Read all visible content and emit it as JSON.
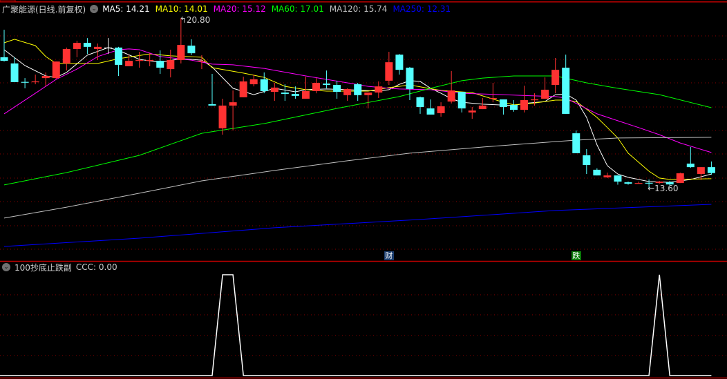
{
  "header": {
    "title": "广聚能源(日线.前复权)",
    "ma_labels": [
      {
        "text": "MA5: 14.21",
        "color": "#ffffff"
      },
      {
        "text": "MA10: 14.01",
        "color": "#ffff00"
      },
      {
        "text": "MA20: 15.12",
        "color": "#ff00ff"
      },
      {
        "text": "MA60: 17.01",
        "color": "#00ff00"
      },
      {
        "text": "MA120: 15.74",
        "color": "#c0c0c0"
      },
      {
        "text": "MA250: 12.31",
        "color": "#0000ff"
      }
    ]
  },
  "annotations": {
    "high": "20.80",
    "low": "13.60"
  },
  "markers": [
    {
      "text": "财",
      "candle": 37,
      "bg": "#1a3d6e"
    },
    {
      "text": "跌",
      "candle": 55,
      "bg": "#0a7a0a"
    }
  ],
  "indicator": {
    "title": "100抄底止跌副",
    "value_label": "CCC: 0.00",
    "signal_candles": [
      21,
      22,
      63
    ]
  },
  "colors": {
    "up": "#ff3232",
    "down": "#54ffff",
    "grid": "#8b0000",
    "separator": "#c00000"
  },
  "chart_data": {
    "type": "candlestick",
    "price_range": [
      11.0,
      20.8
    ],
    "candles": [
      [
        19.14,
        20.3,
        18.96,
        18.99
      ],
      [
        18.88,
        19.14,
        18.09,
        18.09
      ],
      [
        18.1,
        18.26,
        17.83,
        18.09
      ],
      [
        18.11,
        18.41,
        18.0,
        18.12
      ],
      [
        18.26,
        18.5,
        17.91,
        18.35
      ],
      [
        18.26,
        18.96,
        18.22,
        18.96
      ],
      [
        18.88,
        19.55,
        18.58,
        19.49
      ],
      [
        19.49,
        19.84,
        19.14,
        19.75
      ],
      [
        19.75,
        19.95,
        19.28,
        19.58
      ],
      [
        19.49,
        19.72,
        19.02,
        19.58
      ],
      [
        19.55,
        19.95,
        19.28,
        19.55
      ],
      [
        19.55,
        19.58,
        18.35,
        18.82
      ],
      [
        18.76,
        19.25,
        18.76,
        18.99
      ],
      [
        19.01,
        19.37,
        18.7,
        19.02
      ],
      [
        19.01,
        19.31,
        18.76,
        19.02
      ],
      [
        18.99,
        19.43,
        18.44,
        18.7
      ],
      [
        18.64,
        19.46,
        18.29,
        19.02
      ],
      [
        19.02,
        20.8,
        18.88,
        19.66
      ],
      [
        19.63,
        19.9,
        19.23,
        19.31
      ],
      [
        18.98,
        19.23,
        18.64,
        18.99
      ],
      [
        17.16,
        18.44,
        17.1,
        17.1
      ],
      [
        16.14,
        17.39,
        15.87,
        17.1
      ],
      [
        17.1,
        17.74,
        16.05,
        17.24
      ],
      [
        17.45,
        18.32,
        17.45,
        18.12
      ],
      [
        18.0,
        18.41,
        17.91,
        18.21
      ],
      [
        18.21,
        18.5,
        17.62,
        17.71
      ],
      [
        17.68,
        18.06,
        17.3,
        17.86
      ],
      [
        17.65,
        18.0,
        17.3,
        17.59
      ],
      [
        17.59,
        17.91,
        17.39,
        17.51
      ],
      [
        17.39,
        18.32,
        17.39,
        17.71
      ],
      [
        17.71,
        18.26,
        17.62,
        18.06
      ],
      [
        18.03,
        18.58,
        17.83,
        17.97
      ],
      [
        17.97,
        18.15,
        17.39,
        17.68
      ],
      [
        17.54,
        17.83,
        17.3,
        17.8
      ],
      [
        18.0,
        18.06,
        17.3,
        17.54
      ],
      [
        17.54,
        17.65,
        16.98,
        17.65
      ],
      [
        17.65,
        18.12,
        17.42,
        17.91
      ],
      [
        18.15,
        19.37,
        17.97,
        18.93
      ],
      [
        19.25,
        19.28,
        18.41,
        18.61
      ],
      [
        18.7,
        18.73,
        17.33,
        17.8
      ],
      [
        17.45,
        17.48,
        16.75,
        17.04
      ],
      [
        16.98,
        17.36,
        16.72,
        16.72
      ],
      [
        16.78,
        17.24,
        16.63,
        17.07
      ],
      [
        17.27,
        18.56,
        17.19,
        17.74
      ],
      [
        17.68,
        17.68,
        16.81,
        16.98
      ],
      [
        16.81,
        17.04,
        16.54,
        16.89
      ],
      [
        16.95,
        17.42,
        16.95,
        17.1
      ],
      [
        17.41,
        18.06,
        17.24,
        17.42
      ],
      [
        17.36,
        17.36,
        16.72,
        17.04
      ],
      [
        17.13,
        17.33,
        16.84,
        16.92
      ],
      [
        16.92,
        17.94,
        16.81,
        17.33
      ],
      [
        17.35,
        17.62,
        17.1,
        17.36
      ],
      [
        17.39,
        18.29,
        17.39,
        17.77
      ],
      [
        17.97,
        19.11,
        17.62,
        18.61
      ],
      [
        18.7,
        19.25,
        16.75,
        16.75
      ],
      [
        15.93,
        16.05,
        15.09,
        15.09
      ],
      [
        15.0,
        15.26,
        14.21,
        14.59
      ],
      [
        14.39,
        14.45,
        14.15,
        14.15
      ],
      [
        14.07,
        14.27,
        14.04,
        14.15
      ],
      [
        14.15,
        14.15,
        13.76,
        13.89
      ],
      [
        13.86,
        13.89,
        13.76,
        13.8
      ],
      [
        13.8,
        13.89,
        13.8,
        13.83
      ],
      [
        13.84,
        13.98,
        13.6,
        13.83
      ],
      [
        13.83,
        13.92,
        13.8,
        13.89
      ],
      [
        13.86,
        13.92,
        13.74,
        13.77
      ],
      [
        13.83,
        14.27,
        13.83,
        14.24
      ],
      [
        14.65,
        15.35,
        14.47,
        14.5
      ],
      [
        14.21,
        14.5,
        13.95,
        14.5
      ],
      [
        14.5,
        14.74,
        14.18,
        14.25
      ]
    ],
    "moving_averages": [
      {
        "name": "MA5",
        "color": "#ffffff",
        "points": [
          [
            0,
            19.46
          ],
          [
            2,
            18.79
          ],
          [
            4,
            18.35
          ],
          [
            5,
            18.29
          ],
          [
            6,
            18.5
          ],
          [
            8,
            19.23
          ],
          [
            10,
            19.55
          ],
          [
            11,
            19.43
          ],
          [
            13,
            19.05
          ],
          [
            15,
            18.93
          ],
          [
            17,
            19.08
          ],
          [
            19,
            19.02
          ],
          [
            20,
            18.73
          ],
          [
            22,
            17.83
          ],
          [
            24,
            17.56
          ],
          [
            26,
            17.83
          ],
          [
            28,
            17.68
          ],
          [
            29,
            17.77
          ],
          [
            31,
            17.8
          ],
          [
            33,
            17.77
          ],
          [
            36,
            17.71
          ],
          [
            37,
            17.77
          ],
          [
            38,
            18.0
          ],
          [
            39,
            18.15
          ],
          [
            40,
            18.12
          ],
          [
            41,
            17.83
          ],
          [
            42,
            17.62
          ],
          [
            43,
            17.39
          ],
          [
            44,
            17.24
          ],
          [
            46,
            17.16
          ],
          [
            49,
            17.1
          ],
          [
            50,
            17.19
          ],
          [
            52,
            17.27
          ],
          [
            53,
            17.56
          ],
          [
            54,
            17.59
          ],
          [
            55,
            17.33
          ],
          [
            56,
            16.6
          ],
          [
            57,
            15.44
          ],
          [
            58,
            14.56
          ],
          [
            59,
            14.21
          ],
          [
            60,
            14.07
          ],
          [
            62,
            13.89
          ],
          [
            64,
            13.86
          ],
          [
            66,
            13.98
          ],
          [
            68,
            14.21
          ]
        ]
      },
      {
        "name": "MA10",
        "color": "#ffff00",
        "points": [
          [
            0,
            19.75
          ],
          [
            1,
            19.9
          ],
          [
            3,
            19.63
          ],
          [
            4,
            19.17
          ],
          [
            5,
            18.88
          ],
          [
            9,
            18.88
          ],
          [
            11,
            19.08
          ],
          [
            14,
            19.28
          ],
          [
            16,
            19.2
          ],
          [
            19,
            19.14
          ],
          [
            20,
            18.7
          ],
          [
            23,
            18.47
          ],
          [
            25,
            18.29
          ],
          [
            27,
            17.91
          ],
          [
            29,
            17.77
          ],
          [
            31,
            17.71
          ],
          [
            35,
            17.71
          ],
          [
            37,
            17.86
          ],
          [
            39,
            17.97
          ],
          [
            40,
            17.89
          ],
          [
            42,
            17.74
          ],
          [
            45,
            17.65
          ],
          [
            46,
            17.51
          ],
          [
            48,
            17.24
          ],
          [
            49,
            17.13
          ],
          [
            51,
            17.21
          ],
          [
            53,
            17.33
          ],
          [
            54,
            17.33
          ],
          [
            55,
            17.27
          ],
          [
            56,
            16.95
          ],
          [
            57,
            16.6
          ],
          [
            58,
            16.17
          ],
          [
            59,
            15.73
          ],
          [
            60,
            15.09
          ],
          [
            62,
            14.33
          ],
          [
            63,
            14.04
          ],
          [
            64,
            13.98
          ],
          [
            68,
            14.01
          ]
        ]
      },
      {
        "name": "MA20",
        "color": "#ff00ff",
        "points": [
          [
            0,
            16.75
          ],
          [
            3,
            17.62
          ],
          [
            5,
            18.21
          ],
          [
            7,
            18.64
          ],
          [
            9,
            19.17
          ],
          [
            11,
            19.46
          ],
          [
            12,
            19.49
          ],
          [
            13,
            19.46
          ],
          [
            15,
            19.17
          ],
          [
            18,
            19.02
          ],
          [
            20,
            18.85
          ],
          [
            22,
            18.82
          ],
          [
            25,
            18.67
          ],
          [
            29,
            18.35
          ],
          [
            33,
            18.06
          ],
          [
            35,
            17.91
          ],
          [
            37,
            17.83
          ],
          [
            38,
            17.8
          ],
          [
            41,
            17.77
          ],
          [
            44,
            17.62
          ],
          [
            46,
            17.59
          ],
          [
            49,
            17.54
          ],
          [
            53,
            17.48
          ],
          [
            54,
            17.42
          ],
          [
            55,
            17.19
          ],
          [
            57,
            16.75
          ],
          [
            59,
            16.46
          ],
          [
            61,
            16.17
          ],
          [
            63,
            15.87
          ],
          [
            65,
            15.52
          ],
          [
            68,
            15.12
          ]
        ]
      },
      {
        "name": "MA60",
        "color": "#00ff00",
        "points": [
          [
            0,
            13.75
          ],
          [
            6,
            14.27
          ],
          [
            13,
            15.0
          ],
          [
            19,
            15.93
          ],
          [
            25,
            16.34
          ],
          [
            32,
            16.98
          ],
          [
            38,
            17.48
          ],
          [
            41,
            17.83
          ],
          [
            44,
            18.15
          ],
          [
            46,
            18.26
          ],
          [
            49,
            18.35
          ],
          [
            53,
            18.35
          ],
          [
            56,
            18.06
          ],
          [
            59,
            17.83
          ],
          [
            63,
            17.56
          ],
          [
            68,
            17.01
          ]
        ]
      },
      {
        "name": "MA120",
        "color": "#c0c0c0",
        "points": [
          [
            0,
            12.35
          ],
          [
            6,
            12.81
          ],
          [
            13,
            13.4
          ],
          [
            19,
            13.92
          ],
          [
            26,
            14.36
          ],
          [
            33,
            14.77
          ],
          [
            39,
            15.09
          ],
          [
            46,
            15.35
          ],
          [
            53,
            15.58
          ],
          [
            55,
            15.64
          ],
          [
            59,
            15.73
          ],
          [
            68,
            15.76
          ]
        ]
      },
      {
        "name": "MA250",
        "color": "#0000ff",
        "points": [
          [
            0,
            11.15
          ],
          [
            13,
            11.5
          ],
          [
            26,
            11.94
          ],
          [
            40,
            12.29
          ],
          [
            53,
            12.67
          ],
          [
            68,
            12.93
          ]
        ]
      }
    ]
  }
}
